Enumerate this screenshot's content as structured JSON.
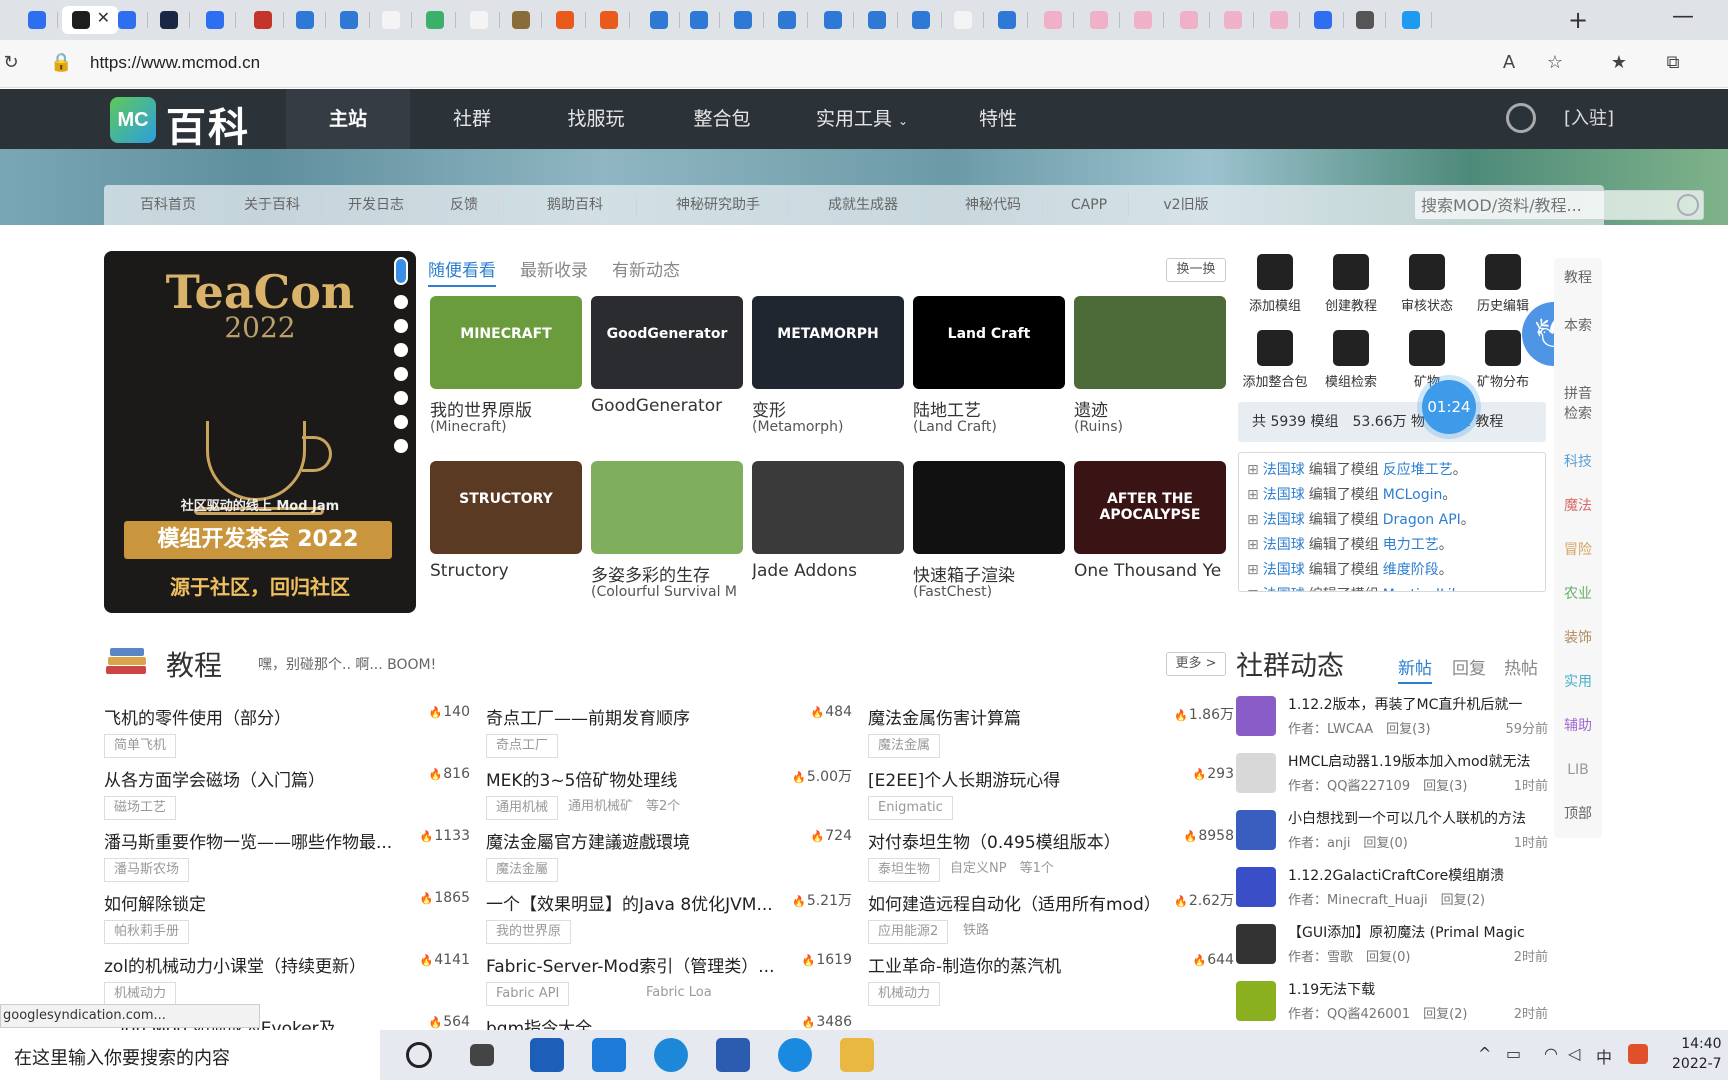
{
  "browser": {
    "url": "https://www.mcmod.cn",
    "tab_favicon_colors": [
      "#2d6ff0",
      "#1e1e1e",
      "#2d6ff0",
      "#1a2744",
      "#2d6ff0",
      "#c5342a",
      "#2e78d6",
      "#2e78d6",
      "#f4f4f4",
      "#3bb06b",
      "#f4f4f4",
      "#8a6b3a",
      "#e85b1c",
      "#e85b1c",
      "#2e78d6",
      "#2e78d6",
      "#2e78d6",
      "#2e78d6",
      "#2e78d6",
      "#2e78d6",
      "#2e78d6",
      "#f4f4f4",
      "#2e78d6",
      "#f0b0c8",
      "#f0b0c8",
      "#f0b0c8",
      "#f0b0c8",
      "#f0b0c8",
      "#f0b0c8",
      "#2d6ff0",
      "#555555",
      "#1e9bf0"
    ]
  },
  "site": {
    "logo_mark": "MC",
    "logo_text": "百科",
    "nav": [
      "主站",
      "社群",
      "找服玩",
      "整合包",
      "实用工具",
      "特性"
    ],
    "join": "[入驻]",
    "subnav": [
      "百科首页",
      "关于百科",
      "开发日志",
      "反馈",
      "鹅助百科",
      "神秘研究助手",
      "成就生成器",
      "神秘代码",
      "CAPP",
      "v2旧版"
    ],
    "search_placeholder": "搜索MOD/资料/教程..."
  },
  "carousel": {
    "title": "TeaCon",
    "year": "2022",
    "subtitle": "社区驱动的线上 Mod Jam",
    "main": "模组开发茶会 2022",
    "motto": "源于社区，回归社区"
  },
  "mods": {
    "tabs": [
      "随便看看",
      "最新收录",
      "有新动态"
    ],
    "swap": "换一换",
    "items": [
      {
        "name": "我的世界原版",
        "sub": "(Minecraft)",
        "thumb": "MINECRAFT",
        "color": "#6a9c3e"
      },
      {
        "name": "GoodGenerator",
        "sub": "",
        "thumb": "GoodGenerator",
        "color": "#2a2c30"
      },
      {
        "name": "变形",
        "sub": "(Metamorph)",
        "thumb": "METAMORPH",
        "color": "#1f2630"
      },
      {
        "name": "陆地工艺",
        "sub": "(Land Craft)",
        "thumb": "Land Craft",
        "color": "#000000"
      },
      {
        "name": "遗迹",
        "sub": "(Ruins)",
        "thumb": "",
        "color": "#4d6b38"
      },
      {
        "name": "Structory",
        "sub": "",
        "thumb": "STRUCTORY",
        "color": "#5a3a22"
      },
      {
        "name": "多姿多彩的生存",
        "sub": "(Colourful Survival M",
        "thumb": "",
        "color": "#7fae5c"
      },
      {
        "name": "Jade Addons",
        "sub": "",
        "thumb": "",
        "color": "#3a3a3a"
      },
      {
        "name": "快速箱子渲染",
        "sub": "(FastChest)",
        "thumb": "",
        "color": "#111111"
      },
      {
        "name": "One Thousand Ye",
        "sub": "",
        "thumb": "AFTER THE APOCALYPSE",
        "color": "#3a1414"
      }
    ]
  },
  "quick_actions": [
    "添加模组",
    "创建教程",
    "审核状态",
    "历史编辑",
    "添加整合包",
    "模组检索",
    "矿物",
    "矿物分布"
  ],
  "stats": "共 5939 模组　53.66万 物　　31 教程",
  "timer": "01:24",
  "feed": [
    {
      "user": "法国球",
      "action": "编辑了模组",
      "mod": "反应堆工艺",
      "end": "。"
    },
    {
      "user": "法国球",
      "action": "编辑了模组",
      "mod": "MCLogin",
      "end": "。"
    },
    {
      "user": "法国球",
      "action": "编辑了模组",
      "mod": "Dragon API",
      "end": "。"
    },
    {
      "user": "法国球",
      "action": "编辑了模组",
      "mod": "电力工艺",
      "end": "。"
    },
    {
      "user": "法国球",
      "action": "编辑了模组",
      "mod": "维度阶段",
      "end": "。"
    },
    {
      "user": "法国球",
      "action": "编辑了模组",
      "mod": "MysticalLib",
      "end": "。"
    }
  ],
  "side_cats": [
    {
      "label": "教程",
      "color": "#666666"
    },
    {
      "label": "本索",
      "color": "#666666"
    },
    {
      "label": "拼音检索",
      "color": "#666666"
    },
    {
      "label": "科技",
      "color": "#5aa0d8"
    },
    {
      "label": "魔法",
      "color": "#d86a6a"
    },
    {
      "label": "冒险",
      "color": "#d8a060"
    },
    {
      "label": "农业",
      "color": "#6ab06a"
    },
    {
      "label": "装饰",
      "color": "#b08a60"
    },
    {
      "label": "实用",
      "color": "#4ab0c8"
    },
    {
      "label": "辅助",
      "color": "#a06ad0"
    },
    {
      "label": "LIB",
      "color": "#999999"
    },
    {
      "label": "顶部",
      "color": "#666666"
    }
  ],
  "tutorials": {
    "title": "教程",
    "subtitle": "嘿，别碰那个.. 啊... BOOM!",
    "more": "更多 >",
    "items": [
      {
        "title": "飞机的零件使用（部分）",
        "hits": "140",
        "tag": "简单飞机",
        "tag2": ""
      },
      {
        "title": "奇点工厂——前期发育顺序",
        "hits": "484",
        "tag": "奇点工厂",
        "tag2": ""
      },
      {
        "title": "魔法金属伤害计算篇",
        "hits": "1.86万",
        "tag": "魔法金属",
        "tag2": ""
      },
      {
        "title": "从各方面学会磁场（入门篇）",
        "hits": "816",
        "tag": "磁场工艺",
        "tag2": ""
      },
      {
        "title": "MEK的3~5倍矿物处理线",
        "hits": "5.00万",
        "tag": "通用机械",
        "tag2": "通用机械矿　等2个"
      },
      {
        "title": "[E2EE]个人长期游玩心得",
        "hits": "293",
        "tag": "Enigmatic",
        "tag2": ""
      },
      {
        "title": "潘马斯重要作物一览——哪些作物最...",
        "hits": "1133",
        "tag": "潘马斯农场",
        "tag2": ""
      },
      {
        "title": "魔法金屬官方建議遊戲環境",
        "hits": "724",
        "tag": "魔法金屬",
        "tag2": ""
      },
      {
        "title": "对付泰坦生物（0.495模组版本）",
        "hits": "8958",
        "tag": "泰坦生物",
        "tag2": "自定义NP　等1个"
      },
      {
        "title": "如何解除锁定",
        "hits": "1865",
        "tag": "帕秋莉手册",
        "tag2": ""
      },
      {
        "title": "一个【效果明显】的Java 8优化JVM...",
        "hits": "5.21万",
        "tag": "我的世界原",
        "tag2": ""
      },
      {
        "title": "如何建造远程自动化（适用所有mod）",
        "hits": "2.62万",
        "tag": "应用能源2",
        "tag2": "铁路"
      },
      {
        "title": "zol的机械动力小课堂（持续更新）",
        "hits": "4141",
        "tag": "机械动力",
        "tag2": ""
      },
      {
        "title": "Fabric-Server-Mod索引（管理类）...",
        "hits": "1619",
        "tag": "Fabric API",
        "tag2": "Fabric Loa"
      },
      {
        "title": "工业革命-制造你的蒸汽机",
        "hits": "644",
        "tag": "机械动力",
        "tag2": ""
      },
      {
        "title": "...ion Mod 如何成为Evoker及...",
        "hits": "564",
        "tag": "",
        "tag2": ""
      },
      {
        "title": "bqm指令大全",
        "hits": "3486",
        "tag": "",
        "tag2": ""
      }
    ]
  },
  "community": {
    "title": "社群动态",
    "tabs": [
      "新帖",
      "回复",
      "热帖"
    ],
    "posts": [
      {
        "title": "1.12.2版本，再装了MC直升机后就一",
        "meta": "作者：LWCAA　回复(3)",
        "time": "59分前",
        "color": "#8a5cc8"
      },
      {
        "title": "HMCL启动器1.19版本加入mod就无法",
        "meta": "作者：QQ酱227109　回复(3)",
        "time": "1时前",
        "color": "#d8d8d8"
      },
      {
        "title": "小白想找到一个可以几个人联机的方法",
        "meta": "作者：anji　回复(0)",
        "time": "1时前",
        "color": "#3a5ec0"
      },
      {
        "title": "1.12.2GalactiCraftCore模组崩溃",
        "meta": "作者：Minecraft_Huaji　回复(2)",
        "time": "",
        "color": "#3a4ec8"
      },
      {
        "title": "【GUI添加】原初魔法 (Primal Magic",
        "meta": "作者：雪歌　回复(0)",
        "time": "2时前",
        "color": "#333333"
      },
      {
        "title": "1.19无法下载",
        "meta": "作者：QQ酱426001　回复(2)",
        "time": "2时前",
        "color": "#8ab020"
      }
    ]
  },
  "status_url": "googlesyndication.com...",
  "taskbar": {
    "search": "在这里输入你要搜索的内容",
    "ime": "中",
    "time": "14:40",
    "date": "2022-7"
  }
}
